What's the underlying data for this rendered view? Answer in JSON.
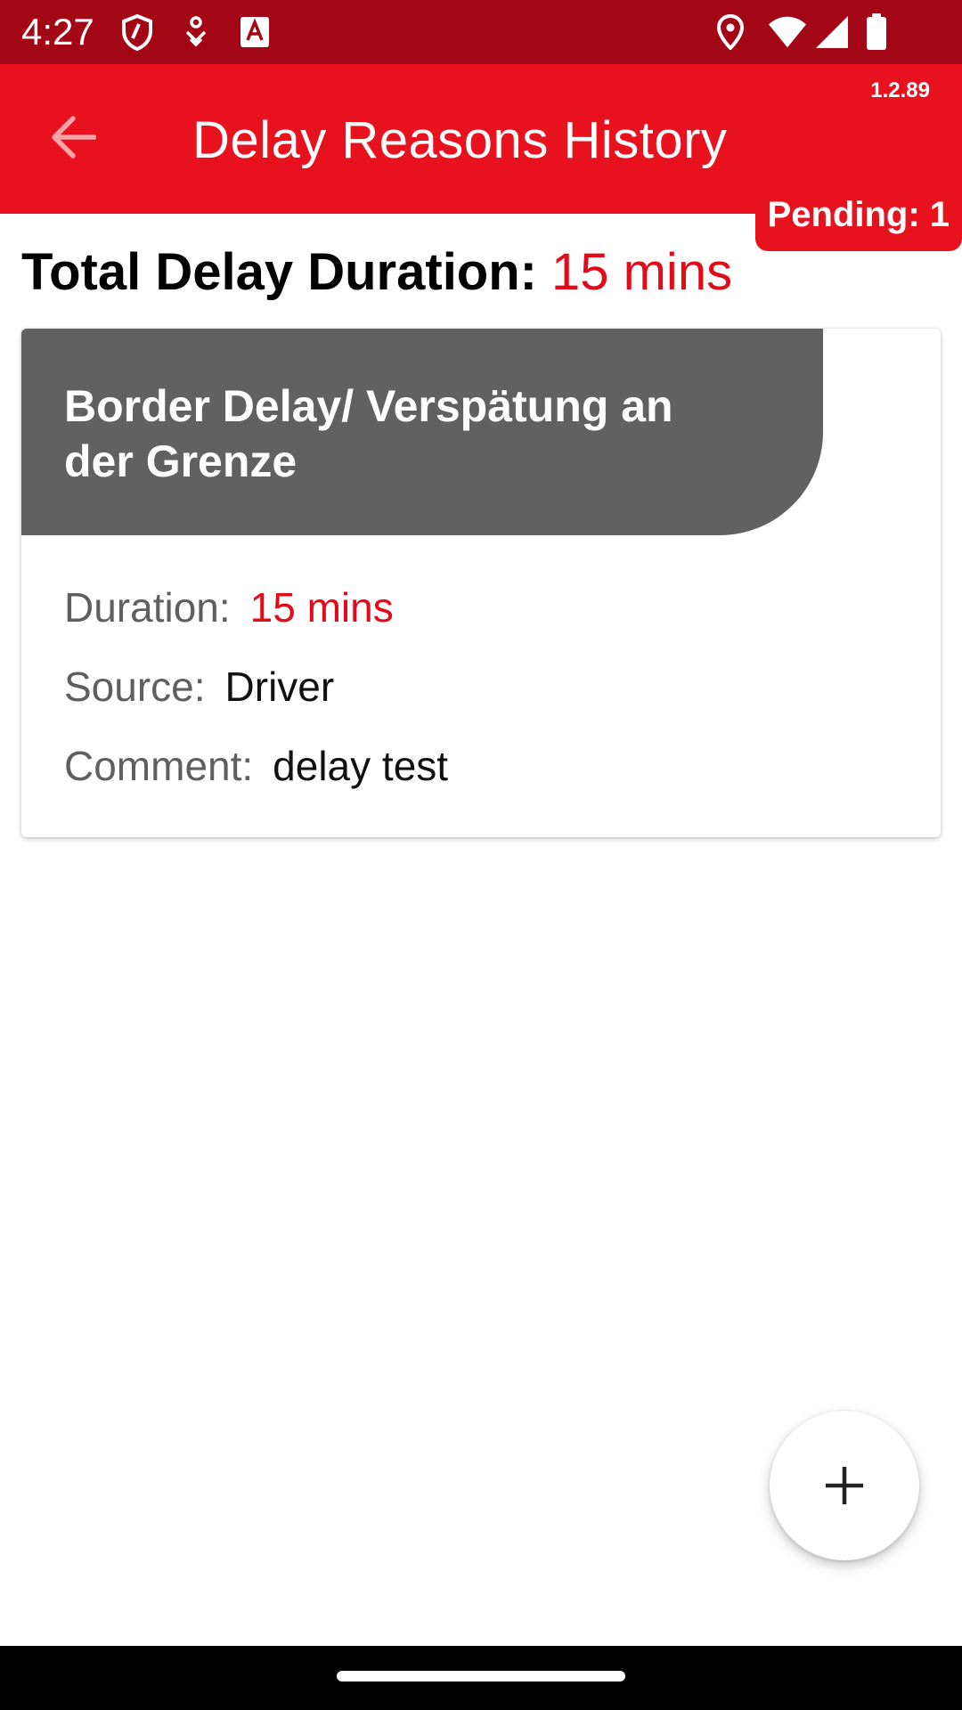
{
  "status_bar": {
    "time": "4:27",
    "icons": [
      "shield-icon",
      "download-notification-icon",
      "font-a-icon",
      "location-icon",
      "wifi-icon",
      "cell-signal-icon",
      "battery-icon"
    ]
  },
  "app_bar": {
    "title": "Delay Reasons History",
    "version": "1.2.89",
    "pending": "Pending: 1",
    "back_icon": "arrow-back-icon"
  },
  "summary": {
    "total_label": "Total Delay Duration:",
    "total_value": "15 mins"
  },
  "delay_card": {
    "title": "Border Delay/ Verspätung an der Grenze",
    "duration_label": "Duration:",
    "duration_value": "15 mins",
    "source_label": "Source:",
    "source_value": "Driver",
    "comment_label": "Comment:",
    "comment_value": "delay test"
  },
  "fab": {
    "icon": "plus-icon"
  },
  "colors": {
    "status_bar": "#a30615",
    "app_bar": "#e8121f",
    "accent_red": "#e10c19",
    "card_header": "#616161"
  }
}
